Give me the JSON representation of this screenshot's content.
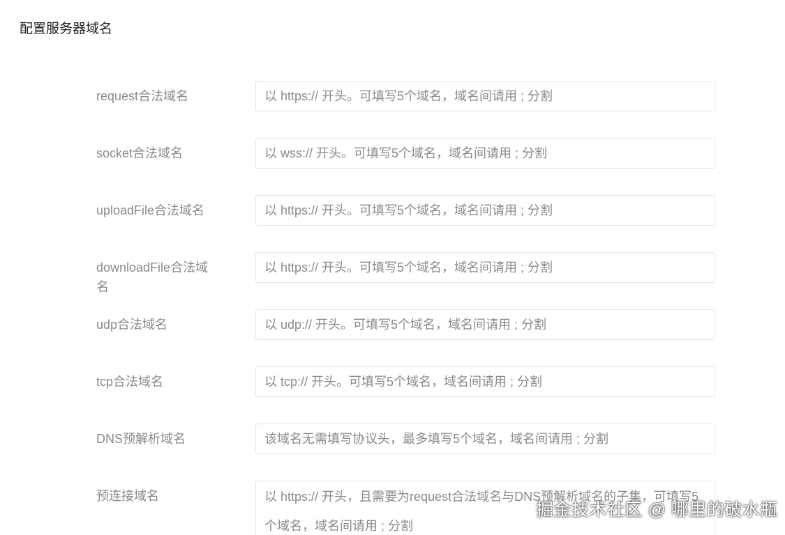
{
  "page": {
    "title": "配置服务器域名"
  },
  "fields": [
    {
      "label": "request合法域名",
      "placeholder": "以 https:// 开头。可填写5个域名，域名间请用 ; 分割"
    },
    {
      "label": "socket合法域名",
      "placeholder": "以 wss:// 开头。可填写5个域名，域名间请用 ; 分割"
    },
    {
      "label": "uploadFile合法域名",
      "placeholder": "以 https:// 开头。可填写5个域名，域名间请用 ; 分割"
    },
    {
      "label": "downloadFile合法域名",
      "placeholder": "以 https:// 开头。可填写5个域名，域名间请用 ; 分割"
    },
    {
      "label": "udp合法域名",
      "placeholder": "以 udp:// 开头。可填写5个域名，域名间请用 ; 分割"
    },
    {
      "label": "tcp合法域名",
      "placeholder": "以 tcp:// 开头。可填写5个域名，域名间请用 ; 分割"
    },
    {
      "label": "DNS预解析域名",
      "placeholder": "该域名无需填写协议头，最多填写5个域名，域名间请用 ; 分割"
    },
    {
      "label": "预连接域名",
      "placeholder": "以 https:// 开头，且需要为request合法域名与DNS预解析域名的子集，可填写5个域名，域名间请用 ; 分割"
    }
  ],
  "watermark": {
    "text": "掘金技术社区 @ 哪里的破水瓶"
  }
}
